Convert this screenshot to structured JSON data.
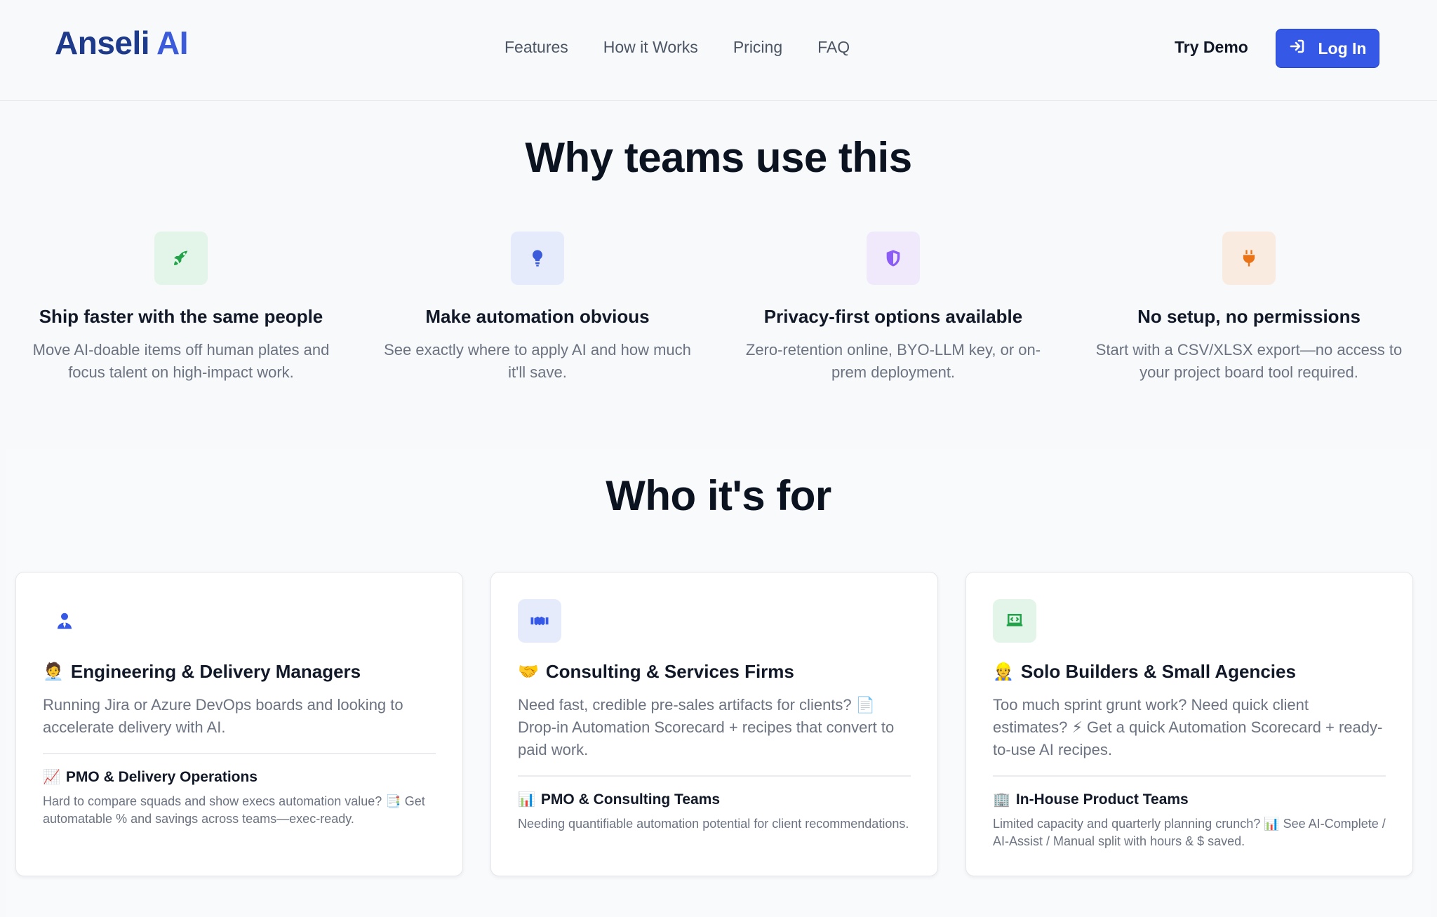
{
  "header": {
    "logo_main": "Anseli",
    "logo_ai": "AI",
    "nav": [
      "Features",
      "How it Works",
      "Pricing",
      "FAQ"
    ],
    "try_demo": "Try Demo",
    "login": "Log In"
  },
  "why": {
    "title": "Why teams use this",
    "features": [
      {
        "icon": "rocket-icon",
        "title": "Ship faster with the same people",
        "desc": "Move AI-doable items off human plates and focus talent on high-impact work."
      },
      {
        "icon": "lightbulb-icon",
        "title": "Make automation obvious",
        "desc": "See exactly where to apply AI and how much it'll save."
      },
      {
        "icon": "shield-icon",
        "title": "Privacy-first options available",
        "desc": "Zero-retention online, BYO-LLM key, or on-prem deployment."
      },
      {
        "icon": "plug-icon",
        "title": "No setup, no permissions",
        "desc": "Start with a CSV/XLSX export—no access to your project board tool required."
      }
    ]
  },
  "who": {
    "title": "Who it's for",
    "cards": [
      {
        "icon": "user-tie-icon",
        "emoji": "🧑‍💼",
        "title": "Engineering & Delivery Managers",
        "desc": "Running Jira or Azure DevOps boards and looking to accelerate delivery with AI.",
        "sub_emoji": "📈",
        "sub_title": "PMO & Delivery Operations",
        "sub_desc": "Hard to compare squads and show execs automation value? 📑 Get automatable % and savings across teams—exec-ready."
      },
      {
        "icon": "handshake-icon",
        "emoji": "🤝",
        "title": "Consulting & Services Firms",
        "desc": "Need fast, credible pre-sales artifacts for clients? 📄 Drop-in Automation Scorecard + recipes that convert to paid work.",
        "sub_emoji": "📊",
        "sub_title": "PMO & Consulting Teams",
        "sub_desc": "Needing quantifiable automation potential for client recommendations."
      },
      {
        "icon": "laptop-code-icon",
        "emoji": "👷",
        "title": "Solo Builders & Small Agencies",
        "desc": "Too much sprint grunt work? Need quick client estimates? ⚡ Get a quick Automation Scorecard + ready-to-use AI recipes.",
        "sub_emoji": "🏢",
        "sub_title": "In-House Product Teams",
        "sub_desc": "Limited capacity and quarterly planning crunch? 📊 See AI-Complete / AI-Assist / Manual split with hours & $ saved."
      }
    ]
  },
  "colors": {
    "primary": "#3558e6",
    "logo": "#1e3a8a",
    "rocket": "#22a34a",
    "bulb": "#3b5bdb",
    "shield": "#8b5cf6",
    "plug": "#ea7317"
  }
}
